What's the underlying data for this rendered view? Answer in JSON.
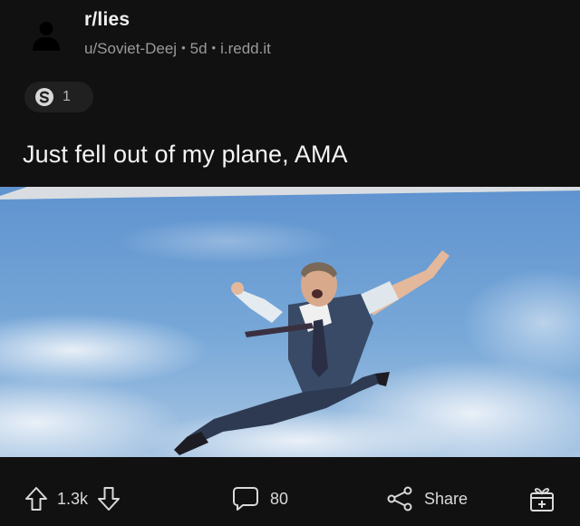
{
  "post": {
    "subreddit": "r/lies",
    "author": "u/Soviet-Deej",
    "age": "5d",
    "domain": "i.redd.it",
    "award_count": "1",
    "title": "Just fell out of my plane, AMA",
    "image_alt": "Man in shirt and tie flying through a blue sky"
  },
  "actions": {
    "score": "1.3k",
    "comments": "80",
    "share_label": "Share"
  },
  "icons": {
    "avatar": "user-icon",
    "award": "silver-award-icon",
    "upvote": "arrow-up-icon",
    "downvote": "arrow-down-icon",
    "comments": "comment-bubble-icon",
    "share": "share-icon",
    "gift": "gift-icon"
  },
  "colors": {
    "background": "#111111",
    "text": "#f4f4f4",
    "meta": "#9a9a9a",
    "sky": "#6f9fd2"
  }
}
